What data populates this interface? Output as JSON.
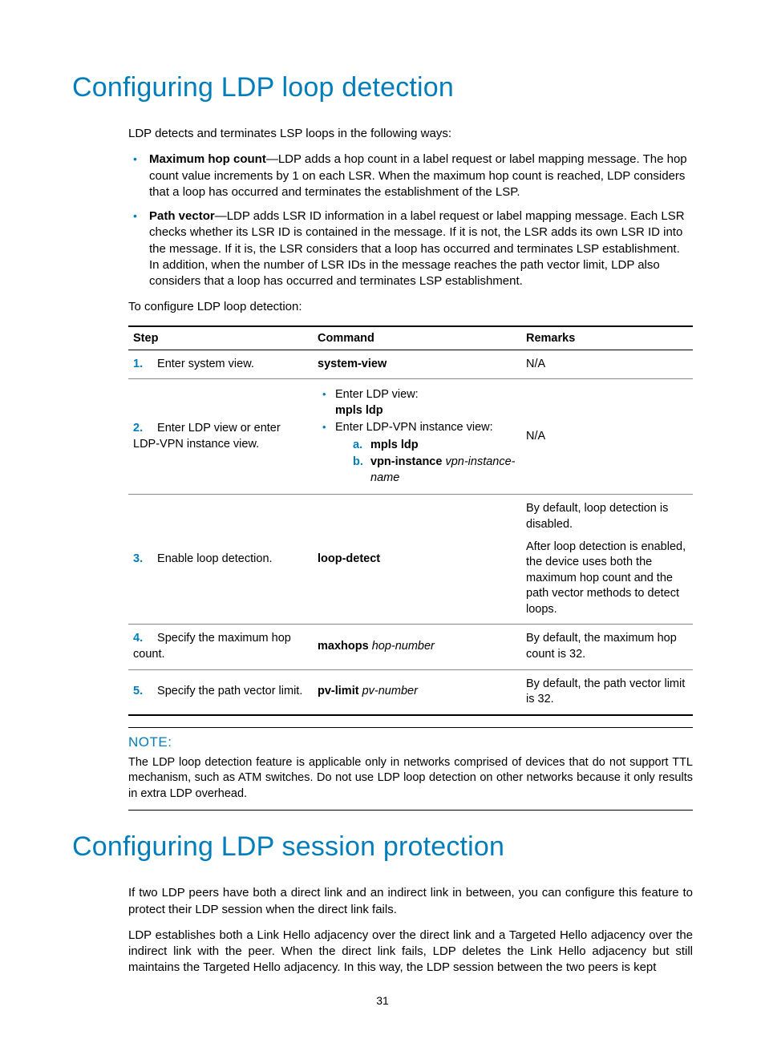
{
  "section1": {
    "title": "Configuring LDP loop detection",
    "intro": "LDP detects and terminates LSP loops in the following ways:",
    "bullets": [
      {
        "lead": "Maximum hop count",
        "text": "—LDP adds a hop count in a label request or label mapping message. The hop count value increments by 1 on each LSR. When the maximum hop count is reached, LDP considers that a loop has occurred and terminates the establishment of the LSP."
      },
      {
        "lead": "Path vector",
        "text": "—LDP adds LSR ID information in a label request or label mapping message. Each LSR checks whether its LSR ID is contained in the message. If it is not, the LSR adds its own LSR ID into the message. If it is, the LSR considers that a loop has occurred and terminates LSP establishment. In addition, when the number of LSR IDs in the message reaches the path vector limit, LDP also considers that a loop has occurred and terminates LSP establishment."
      }
    ],
    "pretable": "To configure LDP loop detection:"
  },
  "table": {
    "headers": {
      "step": "Step",
      "command": "Command",
      "remarks": "Remarks"
    },
    "rows": [
      {
        "n": "1.",
        "step": "Enter system view.",
        "cmd_simple": "system-view",
        "remarks_simple": "N/A"
      },
      {
        "n": "2.",
        "step": "Enter LDP view or enter LDP-VPN instance view.",
        "cmd_list": {
          "a_intro": "Enter LDP view:",
          "a_cmd": "mpls ldp",
          "b_intro": "Enter LDP-VPN instance view:",
          "b_sub_a": "mpls ldp",
          "b_sub_b_bold": "vpn-instance",
          "b_sub_b_ital": "vpn-instance-name"
        },
        "remarks_simple": "N/A"
      },
      {
        "n": "3.",
        "step": "Enable loop detection.",
        "cmd_simple": "loop-detect",
        "remarks_multi": {
          "p1": "By default, loop detection is disabled.",
          "p2": "After loop detection is enabled, the device uses both the maximum hop count and the path vector methods to detect loops."
        }
      },
      {
        "n": "4.",
        "step": "Specify the maximum hop count.",
        "cmd_bold": "maxhops",
        "cmd_ital": "hop-number",
        "remarks_simple": "By default, the maximum hop count is 32."
      },
      {
        "n": "5.",
        "step": "Specify the path vector limit.",
        "cmd_bold": "pv-limit",
        "cmd_ital": "pv-number",
        "remarks_simple": "By default, the path vector limit is 32."
      }
    ]
  },
  "note": {
    "title": "NOTE:",
    "text": "The LDP loop detection feature is applicable only in networks comprised of devices that do not support TTL mechanism, such as ATM switches. Do not use LDP loop detection on other networks because it only results in extra LDP overhead."
  },
  "section2": {
    "title": "Configuring LDP session protection",
    "p1": "If two LDP peers have both a direct link and an indirect link in between, you can configure this feature to protect their LDP session when the direct link fails.",
    "p2": "LDP establishes both a Link Hello adjacency over the direct link and a Targeted Hello adjacency over the indirect link with the peer. When the direct link fails, LDP deletes the Link Hello adjacency but still maintains the Targeted Hello adjacency. In this way, the LDP session between the two peers is kept"
  },
  "page_number": "31"
}
